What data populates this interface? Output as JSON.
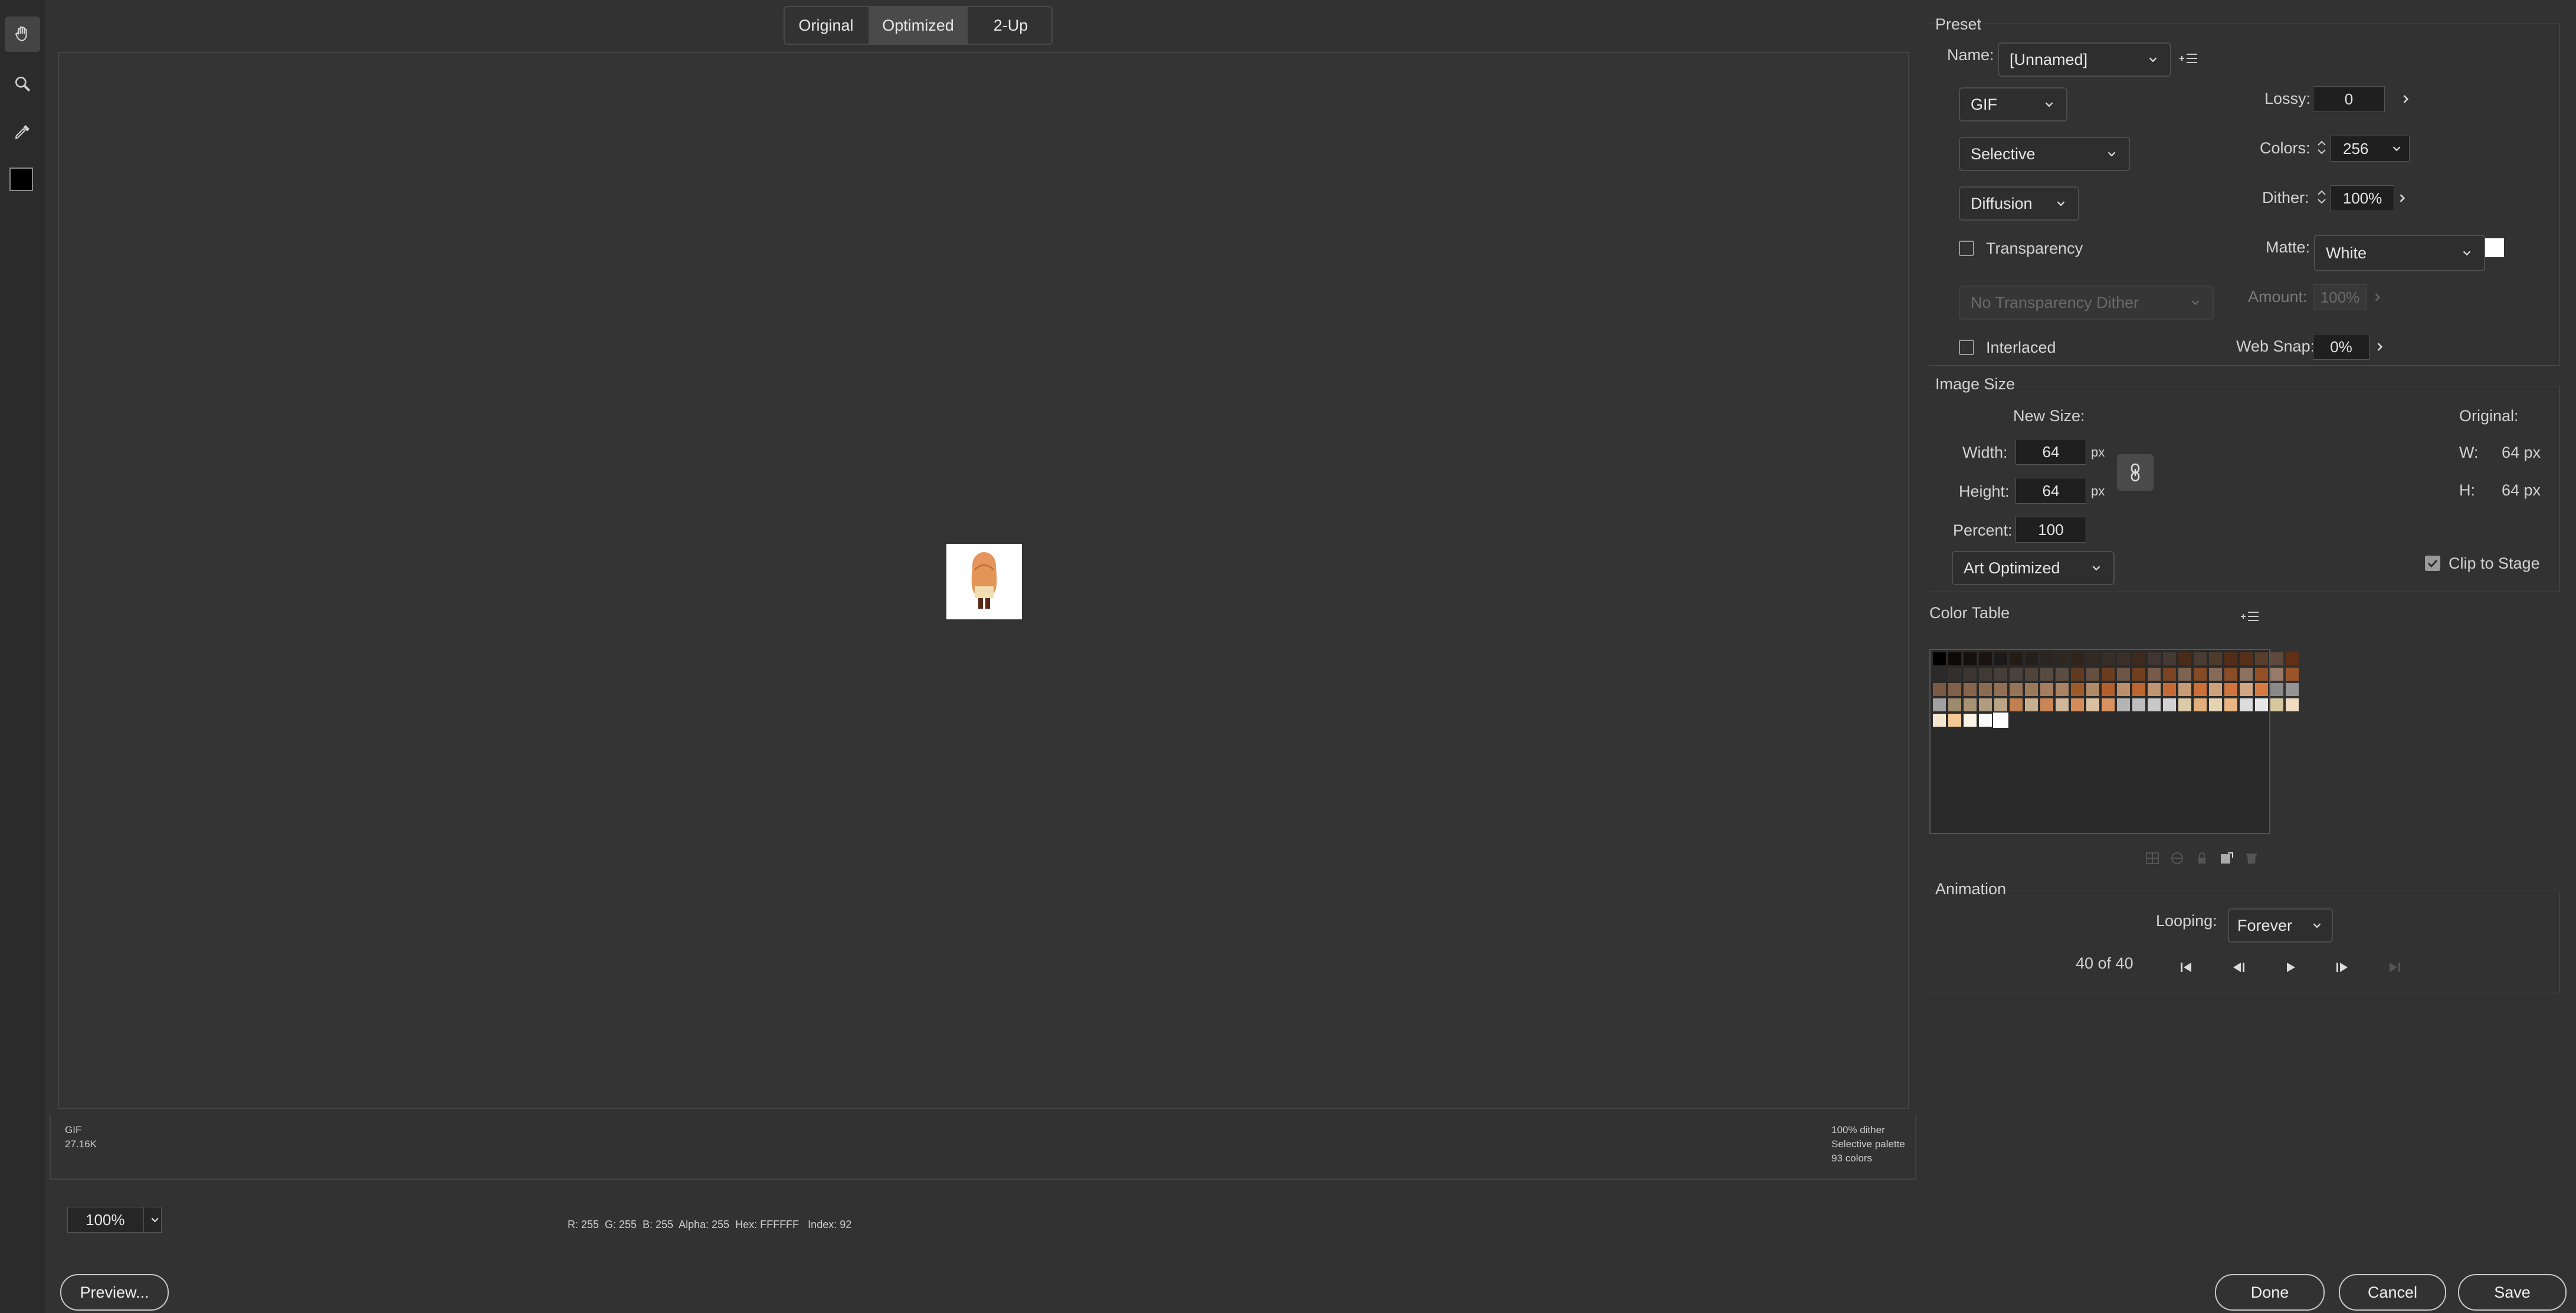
{
  "tabs": [
    "Original",
    "Optimized",
    "2-Up"
  ],
  "canvas": {
    "info_left": [
      "GIF",
      "27.16K"
    ],
    "info_right": [
      "100% dither",
      "Selective palette",
      "93 colors"
    ]
  },
  "zoom": "100%",
  "pixel_readout": "R: 255  G: 255  B: 255  Alpha: 255  Hex: FFFFFF   Index: 92",
  "buttons": {
    "preview": "Preview...",
    "done": "Done",
    "cancel": "Cancel",
    "save": "Save"
  },
  "preset": {
    "section": "Preset",
    "name_label": "Name:",
    "name_value": "[Unnamed]",
    "format": "GIF",
    "palette": "Selective",
    "dither_algo": "Diffusion",
    "transparency_label": "Transparency",
    "transparency_dither": "No Transparency Dither",
    "interlaced_label": "Interlaced",
    "lossy_label": "Lossy:",
    "lossy_value": "0",
    "colors_label": "Colors:",
    "colors_value": "256",
    "dither_label": "Dither:",
    "dither_value": "100%",
    "matte_label": "Matte:",
    "matte_value": "White",
    "matte_color": "#ffffff",
    "amount_label": "Amount:",
    "amount_value": "100%",
    "websnap_label": "Web Snap:",
    "websnap_value": "0%"
  },
  "image_size": {
    "section": "Image Size",
    "new_size_label": "New Size:",
    "width_label": "Width:",
    "width_value": "64",
    "height_label": "Height:",
    "height_value": "64",
    "percent_label": "Percent:",
    "percent_value": "100",
    "unit": "px",
    "quality": "Art Optimized",
    "original_label": "Original:",
    "orig_w_label": "W:",
    "orig_w_value": "64 px",
    "orig_h_label": "H:",
    "orig_h_value": "64 px",
    "clip_label": "Clip to Stage",
    "clip_checked": true
  },
  "color_table": {
    "section": "Color Table",
    "colors": [
      "#000000",
      "#0d0a08",
      "#14100d",
      "#1a1411",
      "#1c1a18",
      "#231b16",
      "#26201c",
      "#2a2522",
      "#2e2824",
      "#30231a",
      "#332a24",
      "#372e27",
      "#3a3029",
      "#3d2a1e",
      "#403530",
      "#443a33",
      "#4a2a18",
      "#4b3c33",
      "#4f3b2c",
      "#532d17",
      "#57301a",
      "#5a3e2c",
      "#5e4a3d",
      "#622f14",
      "#2c2a28",
      "#34302c",
      "#3b3630",
      "#403a35",
      "#463f39",
      "#4b433b",
      "#50443a",
      "#574a3f",
      "#5b4d42",
      "#613a20",
      "#654f40",
      "#6b3d1f",
      "#6d5646",
      "#713f1e",
      "#775b48",
      "#7a4422",
      "#7f6351",
      "#844a25",
      "#876a57",
      "#8b4d27",
      "#8e7260",
      "#934f26",
      "#977a67",
      "#9c5528",
      "#7a5a43",
      "#806048",
      "#86654c",
      "#8c6a50",
      "#926f54",
      "#977458",
      "#9d795c",
      "#a37e60",
      "#a98363",
      "#a05a2a",
      "#b08967",
      "#b5602c",
      "#b98f6c",
      "#be6631",
      "#c09571",
      "#c46b35",
      "#c69b76",
      "#cc7038",
      "#cca17c",
      "#d0763d",
      "#d2a782",
      "#d57b42",
      "#8a8a8a",
      "#959595",
      "#a0a0a0",
      "#9e8a6c",
      "#a89375",
      "#b29c7e",
      "#bca587",
      "#c08050",
      "#c6ae90",
      "#ca8656",
      "#d0b799",
      "#d58c5b",
      "#dac0a2",
      "#d99361",
      "#b4b4b4",
      "#bebebe",
      "#c8c8c8",
      "#d2d2d2",
      "#dccaa8",
      "#e2b07d",
      "#e6d2b4",
      "#e8b785",
      "#dcdcdc",
      "#e6e6e6",
      "#d8c8a0",
      "#f0dcc0",
      "#f5e6d0",
      "#f3c894",
      "#fbf3e6",
      "#fafafa",
      "#ffffff"
    ]
  },
  "animation": {
    "section": "Animation",
    "looping_label": "Looping:",
    "looping_value": "Forever",
    "frame_counter": "40 of 40"
  }
}
